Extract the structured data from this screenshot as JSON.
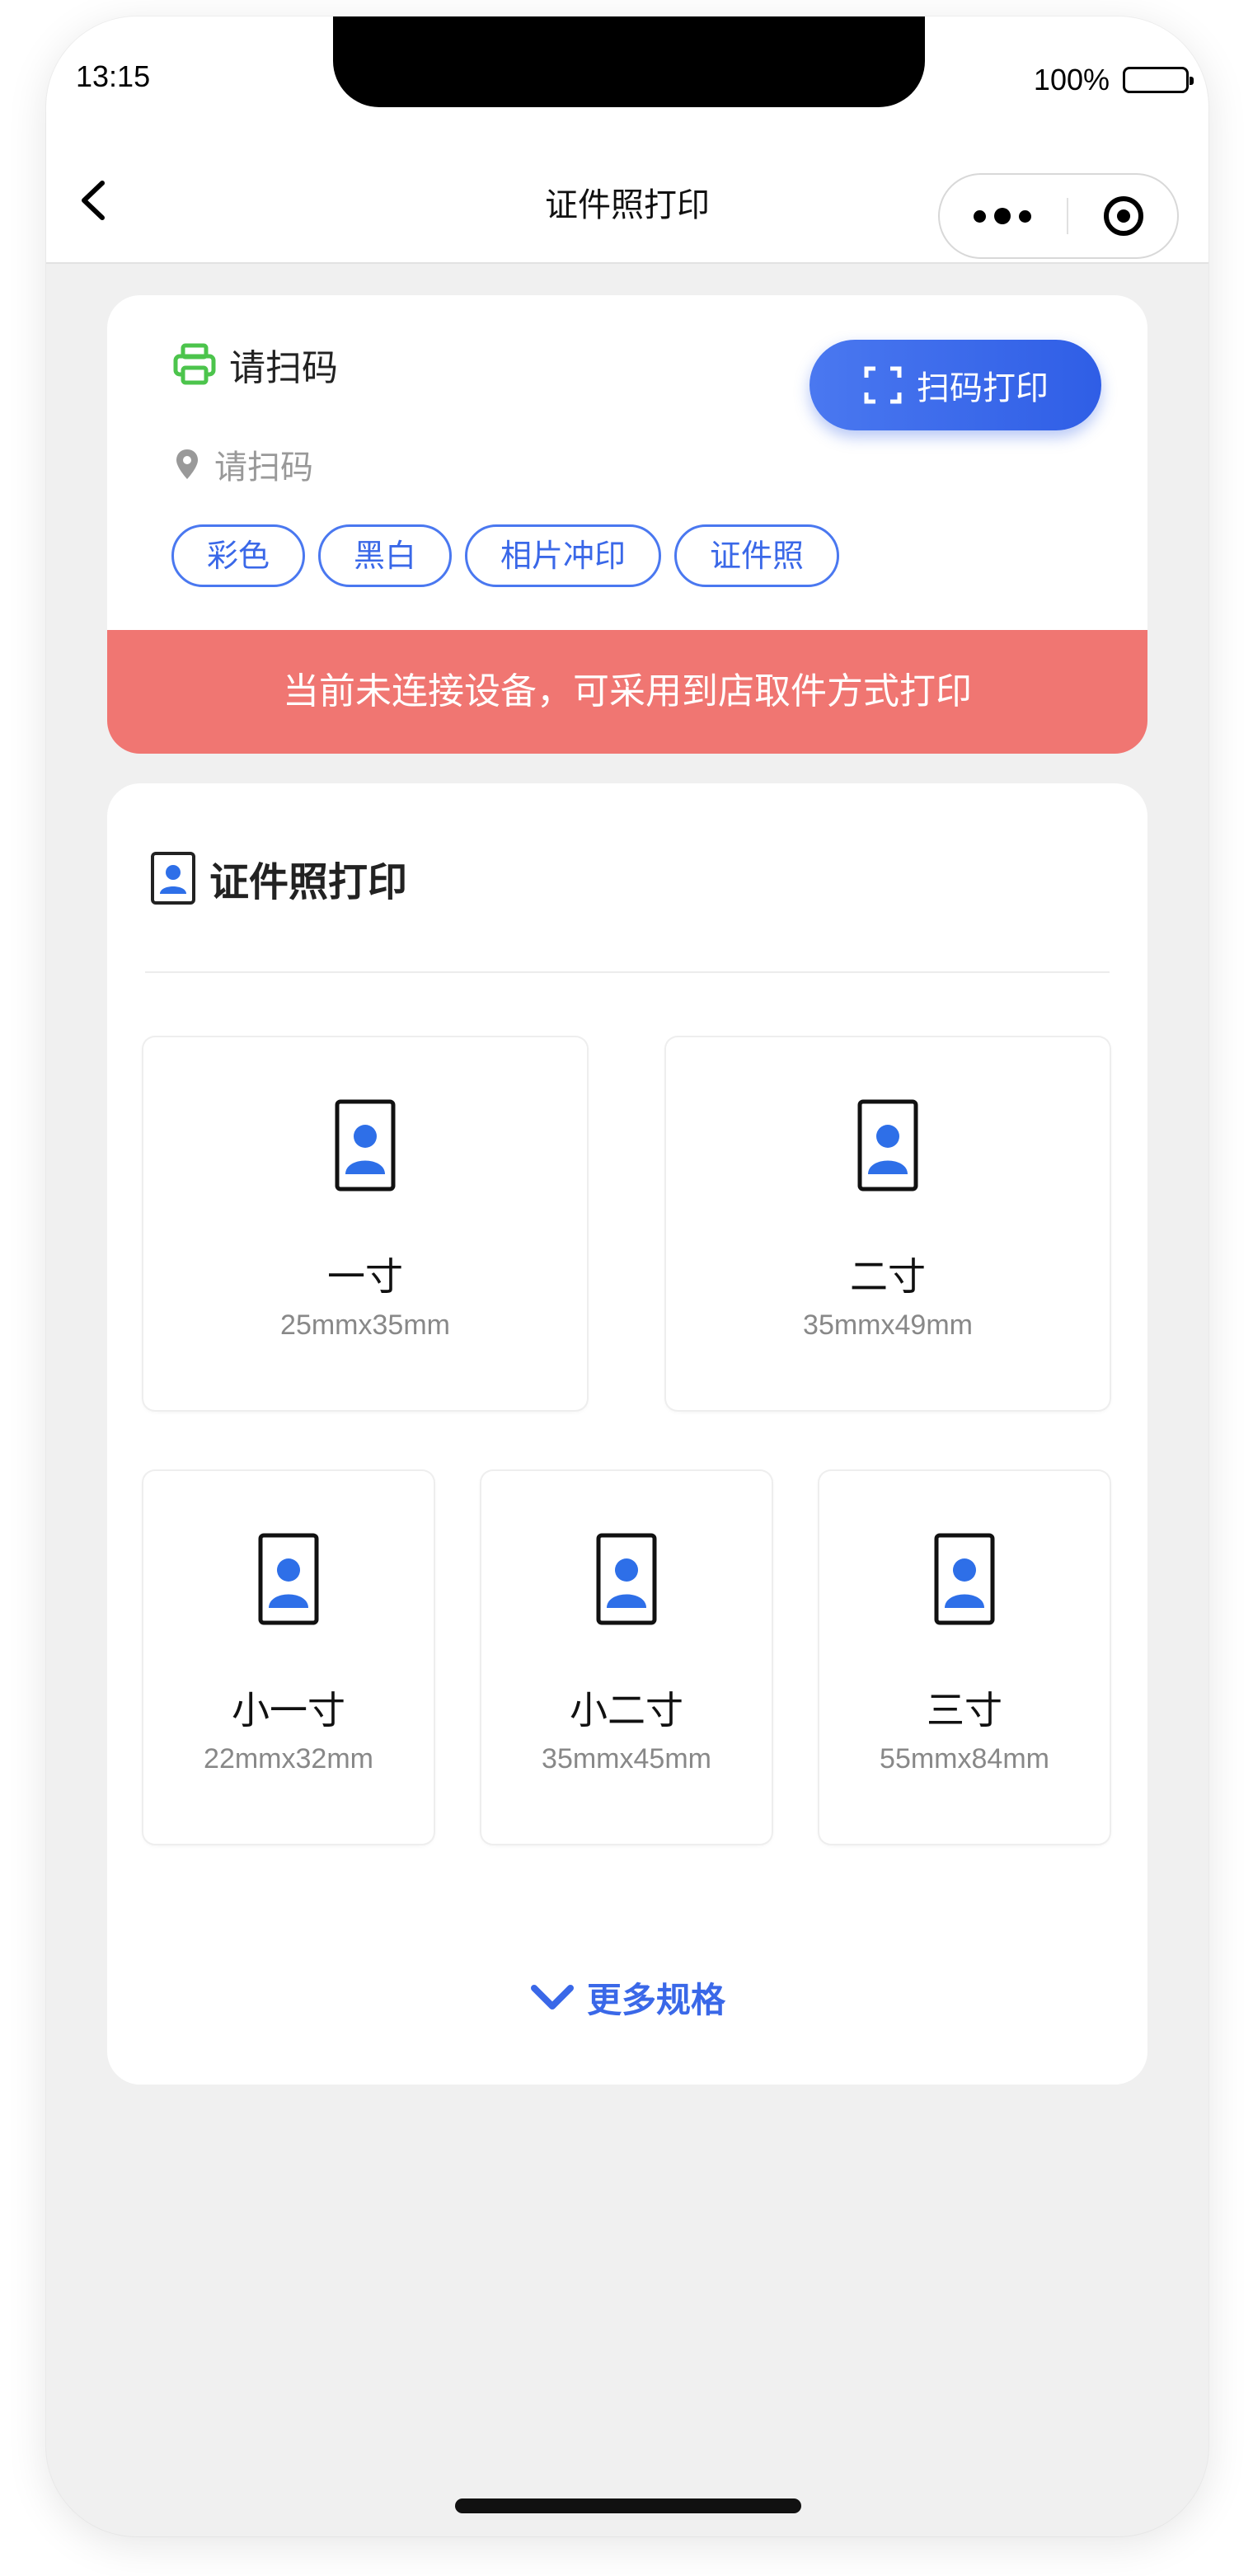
{
  "status_bar": {
    "time": "13:15",
    "battery_percent": "100%"
  },
  "nav": {
    "title": "证件照打印"
  },
  "device": {
    "printer_name": "请扫码",
    "location": "请扫码",
    "scan_button_label": "扫码打印",
    "tags": [
      "彩色",
      "黑白",
      "相片冲印",
      "证件照"
    ],
    "alert": "当前未连接设备，可采用到店取件方式打印"
  },
  "photo_section": {
    "title": "证件照打印",
    "sizes": [
      {
        "name": "一寸",
        "dims": "25mmx35mm"
      },
      {
        "name": "二寸",
        "dims": "35mmx49mm"
      },
      {
        "name": "小一寸",
        "dims": "22mmx32mm"
      },
      {
        "name": "小二寸",
        "dims": "35mmx45mm"
      },
      {
        "name": "三寸",
        "dims": "55mmx84mm"
      }
    ],
    "more_label": "更多规格"
  },
  "colors": {
    "accent_blue": "#3a68e8",
    "alert_red": "#f07672",
    "printer_green": "#4cc44c"
  }
}
